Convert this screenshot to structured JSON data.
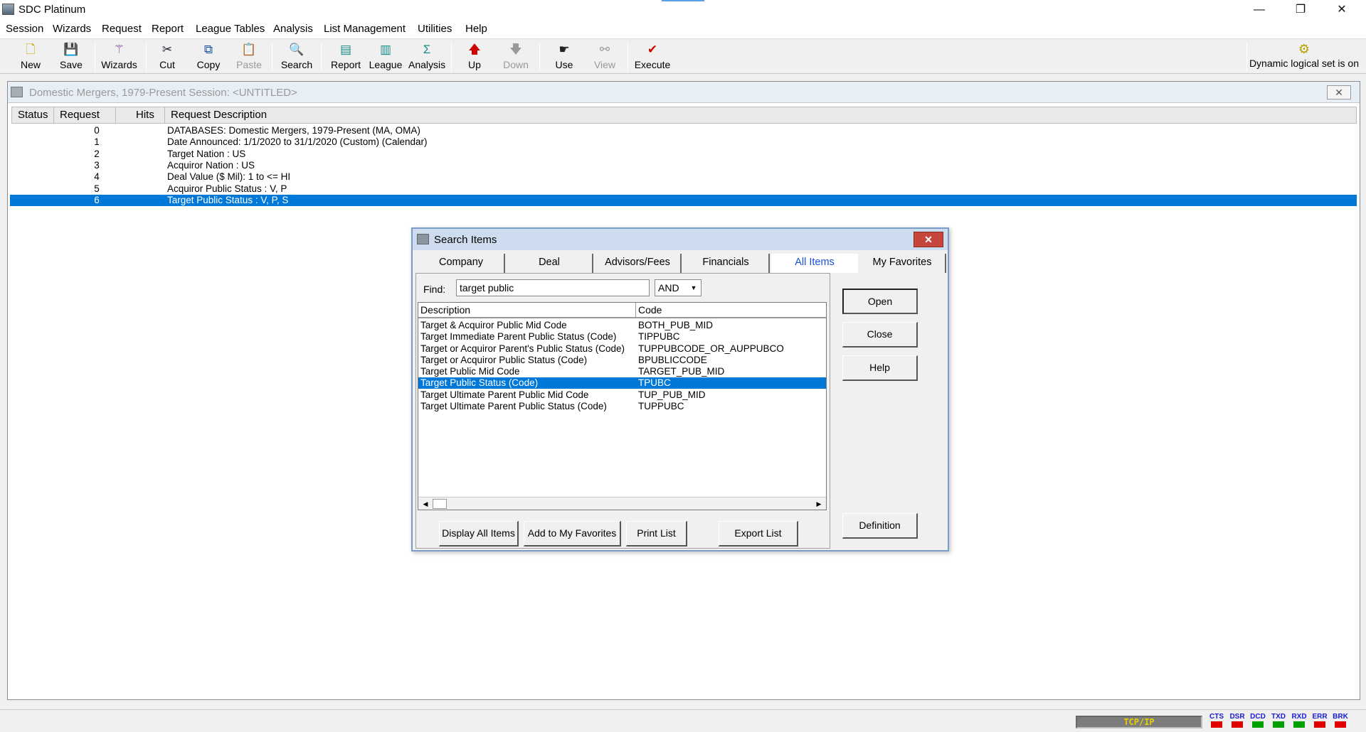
{
  "app": {
    "title": "SDC Platinum"
  },
  "window_controls": {
    "minimize": "—",
    "restore": "❐",
    "close": "✕"
  },
  "menu": [
    "Session",
    "Wizards",
    "Request",
    "Report",
    "League Tables",
    "Analysis",
    "List Management",
    "Utilities",
    "Help"
  ],
  "toolbar": {
    "new": "New",
    "save": "Save",
    "wizards": "Wizards",
    "cut": "Cut",
    "copy": "Copy",
    "paste": "Paste",
    "search": "Search",
    "report": "Report",
    "league": "League",
    "analysis": "Analysis",
    "up": "Up",
    "down": "Down",
    "use": "Use",
    "view": "View",
    "execute": "Execute",
    "dynamic": "Dynamic logical set is on"
  },
  "session": {
    "title": "Domestic Mergers, 1979-Present Session: <UNTITLED>",
    "columns": {
      "status": "Status",
      "request": "Request",
      "hits": "Hits",
      "description": "Request Description"
    },
    "rows": [
      {
        "num": "0",
        "desc": "DATABASES: Domestic Mergers, 1979-Present (MA, OMA)"
      },
      {
        "num": "1",
        "desc": "Date Announced: 1/1/2020 to 31/1/2020 (Custom) (Calendar)"
      },
      {
        "num": "2",
        "desc": "Target Nation : US"
      },
      {
        "num": "3",
        "desc": "Acquiror Nation : US"
      },
      {
        "num": "4",
        "desc": "Deal Value ($ Mil): 1 to <= HI"
      },
      {
        "num": "5",
        "desc": "Acquiror Public Status : V, P"
      },
      {
        "num": "6",
        "desc": "Target Public Status : V, P, S"
      }
    ],
    "selected_row": 6
  },
  "dialog": {
    "title": "Search Items",
    "tabs": [
      "Company",
      "Deal",
      "Advisors/Fees",
      "Financials",
      "All Items",
      "My Favorites"
    ],
    "active_tab": "All Items",
    "find_label": "Find:",
    "find_value": "target public",
    "operator": "AND",
    "columns": {
      "description": "Description",
      "code": "Code"
    },
    "items": [
      {
        "desc": "Target & Acquiror Public Mid Code",
        "code": "BOTH_PUB_MID"
      },
      {
        "desc": "Target Immediate Parent Public Status (Code)",
        "code": "TIPPUBC"
      },
      {
        "desc": "Target or Acquiror Parent's Public Status (Code)",
        "code": "TUPPUBCODE_OR_AUPPUBCO"
      },
      {
        "desc": "Target or Acquiror Public Status (Code)",
        "code": "BPUBLICCODE"
      },
      {
        "desc": "Target Public Mid Code",
        "code": "TARGET_PUB_MID"
      },
      {
        "desc": "Target Public Status (Code)",
        "code": "TPUBC"
      },
      {
        "desc": "Target Ultimate Parent Public Mid Code",
        "code": "TUP_PUB_MID"
      },
      {
        "desc": "Target Ultimate Parent Public Status (Code)",
        "code": "TUPPUBC"
      }
    ],
    "selected_item": 5,
    "buttons": {
      "display_all": "Display All Items",
      "add_favorites": "Add to My Favorites",
      "print_list": "Print List",
      "export_list": "Export List",
      "open": "Open",
      "close": "Close",
      "help": "Help",
      "definition": "Definition"
    }
  },
  "statusbar": {
    "connection": "TCP/IP",
    "indicators": [
      {
        "label": "CTS",
        "color": "#e00000"
      },
      {
        "label": "DSR",
        "color": "#e00000"
      },
      {
        "label": "DCD",
        "color": "#00a000"
      },
      {
        "label": "TXD",
        "color": "#00a000"
      },
      {
        "label": "RXD",
        "color": "#00a000"
      },
      {
        "label": "ERR",
        "color": "#e00000"
      },
      {
        "label": "BRK",
        "color": "#e00000"
      }
    ]
  }
}
